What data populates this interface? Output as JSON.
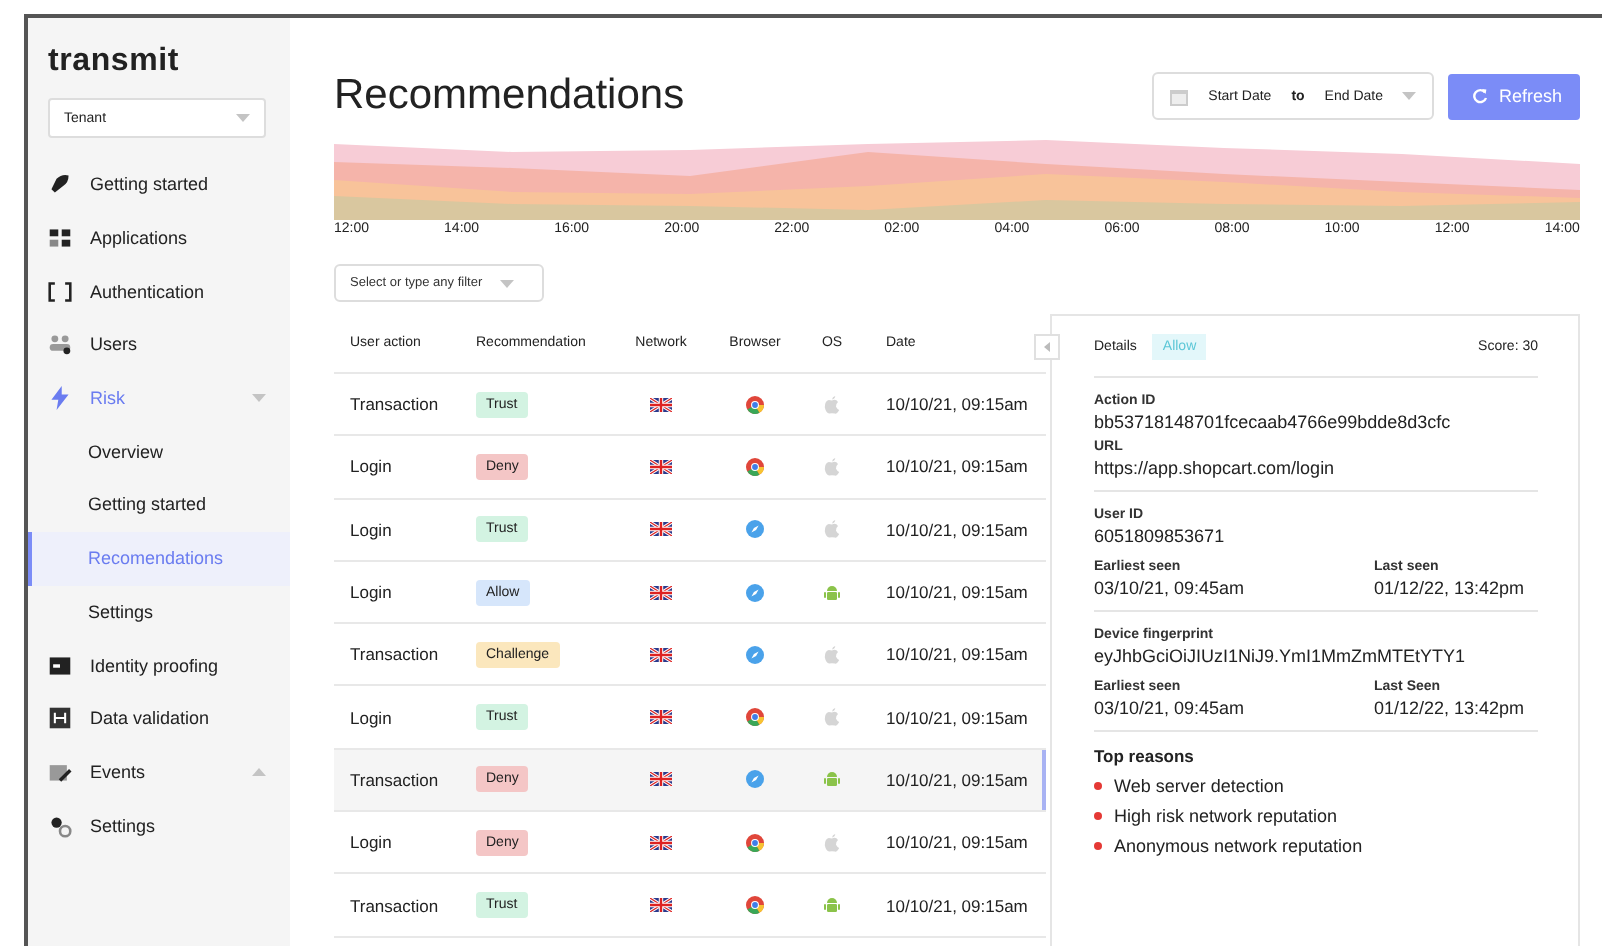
{
  "sidebar": {
    "brand": "transmit",
    "tenant": "Tenant",
    "items": [
      {
        "label": "Getting started",
        "selected": false
      },
      {
        "label": "Applications",
        "selected": false
      },
      {
        "label": "Authentication",
        "selected": false
      },
      {
        "label": "Users",
        "selected": false
      },
      {
        "label": "Risk",
        "selected": false,
        "expanded": true,
        "children": [
          {
            "label": "Overview",
            "selected": false
          },
          {
            "label": "Getting started",
            "selected": false
          },
          {
            "label": "Recomendations",
            "selected": true
          },
          {
            "label": "Settings",
            "selected": false
          }
        ]
      },
      {
        "label": "Identity proofing",
        "selected": false
      },
      {
        "label": "Data validation",
        "selected": false
      },
      {
        "label": "Events",
        "selected": false,
        "expanded": false
      },
      {
        "label": "Settings",
        "selected": false
      }
    ]
  },
  "header": {
    "title": "Recommendations",
    "start_date": "Start Date",
    "to": "to",
    "end_date": "End Date",
    "refresh": "Refresh"
  },
  "chart": {
    "x_labels": [
      "12:00",
      "14:00",
      "16:00",
      "20:00",
      "22:00",
      "02:00",
      "04:00",
      "06:00",
      "08:00",
      "10:00",
      "12:00",
      "14:00"
    ]
  },
  "filter": {
    "placeholder": "Select or type any filter"
  },
  "table": {
    "columns": [
      "User action",
      "Recommendation",
      "Network",
      "Browser",
      "OS",
      "Date"
    ],
    "rows": [
      {
        "user_action": "Transaction",
        "recommendation": "Trust",
        "kind": "trust",
        "browser": {
          "kind": "chrome"
        },
        "os": {
          "kind": "apple"
        },
        "date": "10/10/21, 09:15am",
        "selected": false
      },
      {
        "user_action": "Login",
        "recommendation": "Deny",
        "kind": "deny",
        "browser": {
          "kind": "chrome"
        },
        "os": {
          "kind": "apple"
        },
        "date": "10/10/21, 09:15am",
        "selected": false
      },
      {
        "user_action": "Login",
        "recommendation": "Trust",
        "kind": "trust",
        "browser": {
          "kind": "safari"
        },
        "os": {
          "kind": "apple"
        },
        "date": "10/10/21, 09:15am",
        "selected": false
      },
      {
        "user_action": "Login",
        "recommendation": "Allow",
        "kind": "allow",
        "browser": {
          "kind": "safari"
        },
        "os": {
          "kind": "android"
        },
        "date": "10/10/21, 09:15am",
        "selected": false
      },
      {
        "user_action": "Transaction",
        "recommendation": "Challenge",
        "kind": "challenge",
        "browser": {
          "kind": "safari"
        },
        "os": {
          "kind": "apple"
        },
        "date": "10/10/21, 09:15am",
        "selected": false
      },
      {
        "user_action": "Login",
        "recommendation": "Trust",
        "kind": "trust",
        "browser": {
          "kind": "chrome"
        },
        "os": {
          "kind": "apple"
        },
        "date": "10/10/21, 09:15am",
        "selected": false
      },
      {
        "user_action": "Transaction",
        "recommendation": "Deny",
        "kind": "deny",
        "browser": {
          "kind": "safari"
        },
        "os": {
          "kind": "android"
        },
        "date": "10/10/21, 09:15am",
        "selected": true
      },
      {
        "user_action": "Login",
        "recommendation": "Deny",
        "kind": "deny",
        "browser": {
          "kind": "chrome"
        },
        "os": {
          "kind": "apple"
        },
        "date": "10/10/21, 09:15am",
        "selected": false
      },
      {
        "user_action": "Transaction",
        "recommendation": "Trust",
        "kind": "trust",
        "browser": {
          "kind": "chrome"
        },
        "os": {
          "kind": "android"
        },
        "date": "10/10/21, 09:15am",
        "selected": false
      }
    ]
  },
  "details": {
    "title": "Details",
    "status": "Allow",
    "score": "Score: 30",
    "action_id_label": "Action ID",
    "action_id": "bb53718148701fcecaab4766e99bdde8d3cfc",
    "url_label": "URL",
    "url": "https://app.shopcart.com/login",
    "user_id_label": "User ID",
    "user_id": "6051809853671",
    "user_seen": [
      {
        "label": "Earliest seen",
        "value": "03/10/21, 09:45am"
      },
      {
        "label": "Last seen",
        "value": "01/12/22, 13:42pm"
      }
    ],
    "fingerprint_label": "Device fingerprint",
    "fingerprint": "eyJhbGciOiJIUzI1NiJ9.YmI1MmZmMTEtYTY1",
    "device_seen": [
      {
        "label": "Earliest seen",
        "value": "03/10/21, 09:45am"
      },
      {
        "label": "Last Seen",
        "value": "01/12/22, 13:42pm"
      }
    ],
    "reasons_title": "Top reasons",
    "reasons": [
      "Web server detection",
      "High risk network reputation",
      "Anonymous network reputation"
    ]
  }
}
